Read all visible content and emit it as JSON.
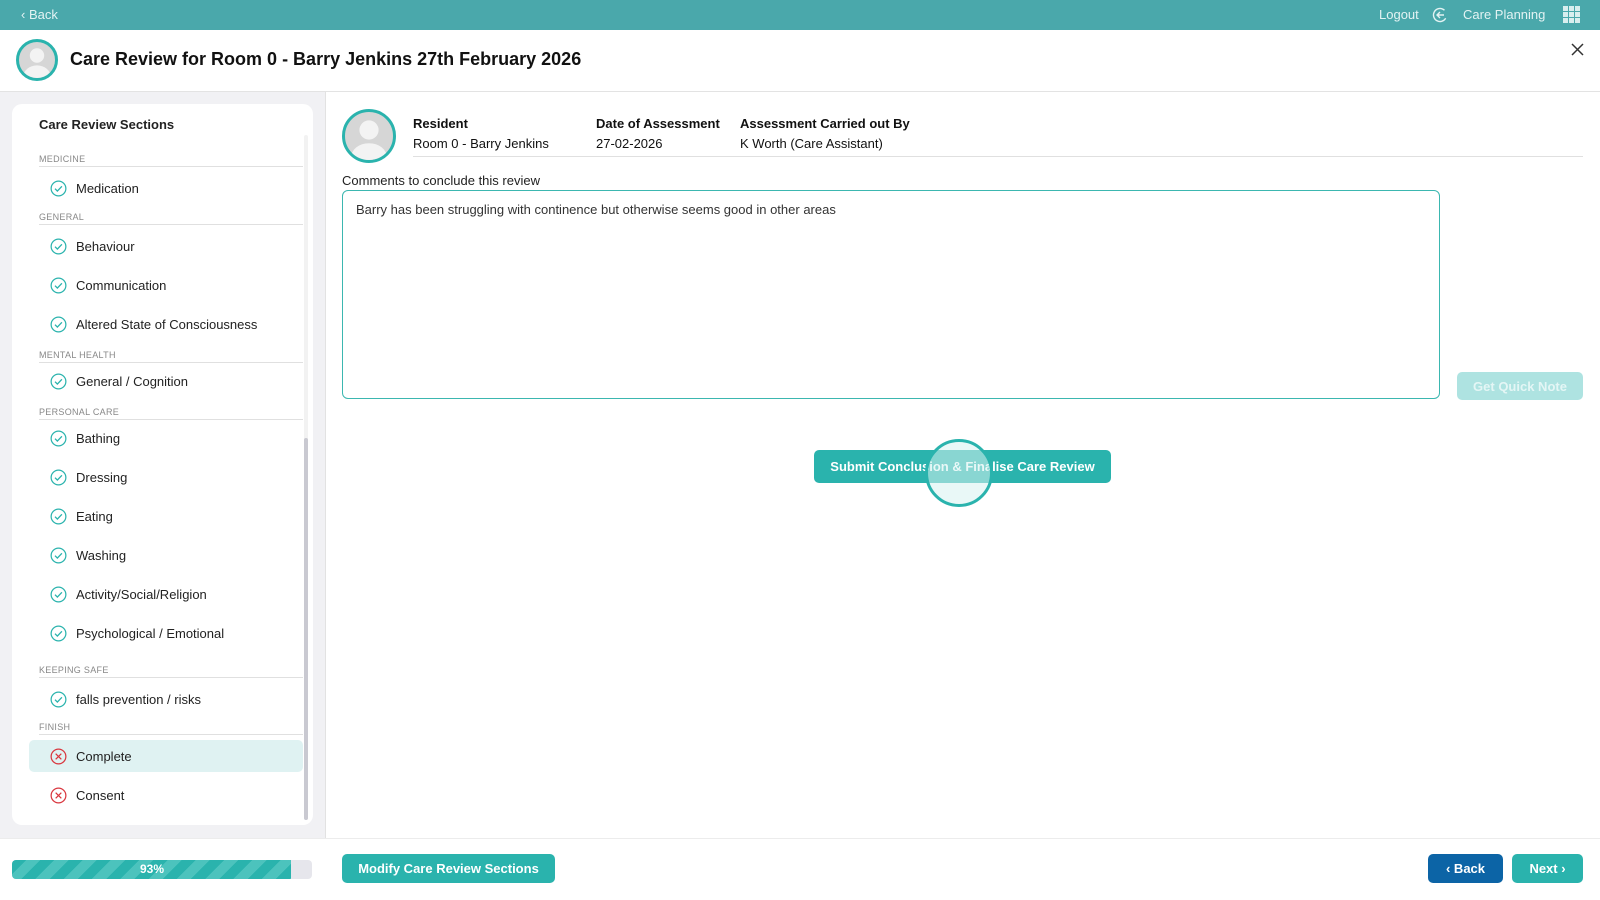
{
  "topbar": {
    "back_label": "‹ Back",
    "logout_label": "Logout",
    "app_label": "Care Planning"
  },
  "header": {
    "title": "Care Review for Room 0 - Barry Jenkins 27th February 2026"
  },
  "sidebar": {
    "title": "Care Review Sections",
    "sections": {
      "medicine": "MEDICINE",
      "general": "GENERAL",
      "mental_health": "MENTAL HEALTH",
      "personal_care": "PERSONAL CARE",
      "keeping_safe": "KEEPING SAFE",
      "finish": "FINISH"
    },
    "items": [
      {
        "label": "Medication",
        "status": "complete"
      },
      {
        "label": "Behaviour",
        "status": "complete"
      },
      {
        "label": "Communication",
        "status": "complete"
      },
      {
        "label": "Altered State of Consciousness",
        "status": "complete"
      },
      {
        "label": "General / Cognition",
        "status": "complete"
      },
      {
        "label": "Bathing",
        "status": "complete"
      },
      {
        "label": "Dressing",
        "status": "complete"
      },
      {
        "label": "Eating",
        "status": "complete"
      },
      {
        "label": "Washing",
        "status": "complete"
      },
      {
        "label": "Activity/Social/Religion",
        "status": "complete"
      },
      {
        "label": "Psychological / Emotional",
        "status": "complete"
      },
      {
        "label": "falls prevention / risks",
        "status": "complete"
      },
      {
        "label": "Complete",
        "status": "incomplete"
      },
      {
        "label": "Consent",
        "status": "incomplete"
      }
    ]
  },
  "info": {
    "resident_label": "Resident",
    "resident_value": "Room 0 - Barry Jenkins",
    "date_label": "Date of Assessment",
    "date_value": "27-02-2026",
    "by_label": "Assessment Carried out By",
    "by_value": "K Worth (Care Assistant)"
  },
  "comments": {
    "label": "Comments to conclude this review",
    "value": "Barry has been struggling with continence but otherwise seems good in other areas"
  },
  "buttons": {
    "quick_note": "Get Quick Note",
    "submit": "Submit Conclusion & Finalise Care Review",
    "modify": "Modify Care Review Sections",
    "back": "‹ Back",
    "next": "Next ›"
  },
  "progress": {
    "percent": 93,
    "label": "93%"
  },
  "colors": {
    "primary": "#2ab3ad",
    "topbar": "#4aa8ab",
    "back_button": "#0c64a6",
    "error": "#d9363e"
  }
}
